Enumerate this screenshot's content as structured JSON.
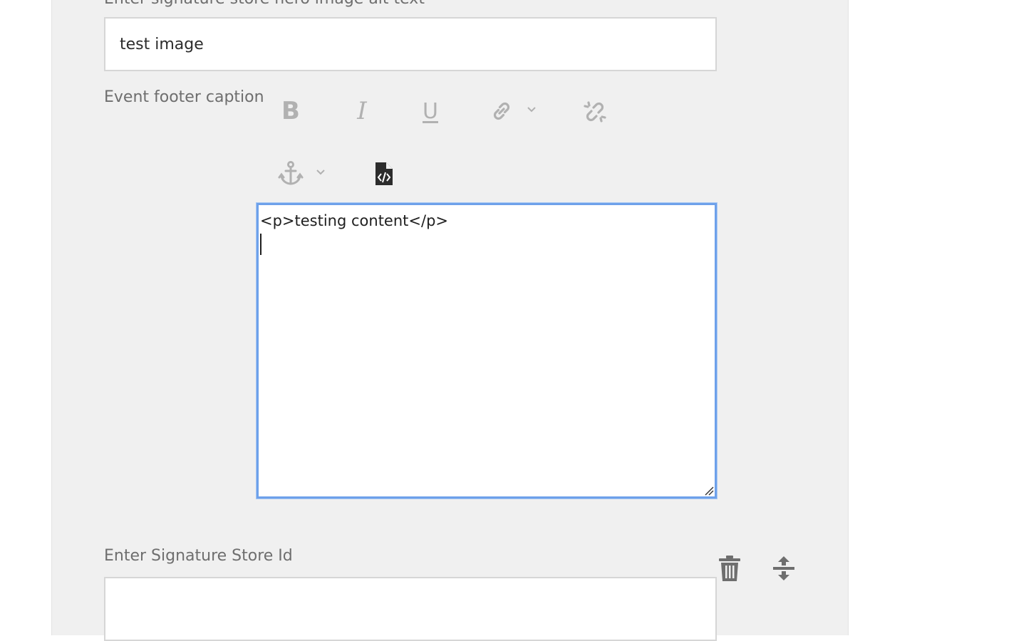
{
  "fields": {
    "alt_text": {
      "label": "Enter signature store hero image alt text",
      "value": "test image"
    },
    "footer_caption": {
      "label": "Event footer caption",
      "content": "<p>testing content</p>"
    },
    "store_id": {
      "label": "Enter Signature Store Id",
      "value": ""
    }
  },
  "toolbar": {
    "bold_glyph": "B",
    "italic_glyph": "I",
    "underline_glyph": "U",
    "icons": [
      "link-icon",
      "unlink-icon",
      "anchor-icon",
      "source-edit-icon"
    ]
  },
  "colors": {
    "panel_bg": "#f0f0f0",
    "focus_border": "#6ea1ea",
    "disabled_icon": "#b1b1b1"
  }
}
